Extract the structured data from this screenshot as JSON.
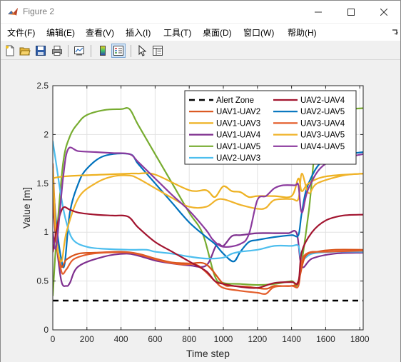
{
  "window": {
    "title": "Figure 2",
    "controls": {
      "minimize": "minimize",
      "maximize": "maximize",
      "close": "close"
    }
  },
  "menu": {
    "items": [
      "文件(F)",
      "编辑(E)",
      "查看(V)",
      "插入(I)",
      "工具(T)",
      "桌面(D)",
      "窗口(W)",
      "帮助(H)"
    ]
  },
  "toolbar": {
    "buttons": [
      "new-figure-icon",
      "open-folder-icon",
      "save-icon",
      "print-icon",
      "link-plot-icon",
      "colorbar-icon",
      "legend-icon",
      "pointer-icon",
      "property-inspector-icon"
    ]
  },
  "chart_data": {
    "type": "line",
    "xlabel": "Time step",
    "ylabel": "Value [m]",
    "xlim": [
      0,
      1820
    ],
    "ylim": [
      0,
      2.5
    ],
    "xticks": [
      0,
      200,
      400,
      600,
      800,
      1000,
      1200,
      1400,
      1600,
      1800
    ],
    "yticks": [
      0,
      0.5,
      1,
      1.5,
      2,
      2.5
    ],
    "ytick_labels": [
      "0",
      "0.5",
      "1",
      "1.5",
      "2",
      "2.5"
    ],
    "grid": true,
    "legend_position": "top-right",
    "series": [
      {
        "name": "Alert Zone",
        "color": "#000000",
        "dashed": true,
        "x": [
          0,
          1820
        ],
        "y": [
          0.3,
          0.3
        ]
      },
      {
        "name": "UAV1-UAV2",
        "color": "#d95319",
        "x": [
          0,
          20,
          50,
          80,
          150,
          250,
          400,
          500,
          600,
          700,
          800,
          900,
          1000,
          1050,
          1150,
          1250,
          1300,
          1400,
          1440,
          1480,
          1550,
          1650,
          1820
        ],
        "y": [
          1.4,
          0.9,
          0.65,
          0.72,
          0.78,
          0.79,
          0.8,
          0.78,
          0.73,
          0.69,
          0.68,
          0.67,
          0.47,
          0.45,
          0.44,
          0.42,
          0.45,
          0.45,
          0.5,
          0.75,
          0.8,
          0.82,
          0.82
        ]
      },
      {
        "name": "UAV1-UAV3",
        "color": "#edb120",
        "x": [
          0,
          20,
          60,
          150,
          300,
          450,
          500,
          600,
          800,
          900,
          950,
          1000,
          1050,
          1100,
          1150,
          1200,
          1300,
          1400,
          1440,
          1460,
          1500,
          1600,
          1820
        ],
        "y": [
          1.55,
          1.56,
          1.57,
          1.58,
          1.59,
          1.6,
          1.6,
          1.59,
          1.43,
          1.43,
          1.36,
          1.47,
          1.42,
          1.41,
          1.36,
          1.37,
          1.37,
          1.37,
          1.55,
          1.42,
          1.5,
          1.57,
          1.6
        ]
      },
      {
        "name": "UAV1-UAV4",
        "color": "#7e2f8e",
        "x": [
          0,
          20,
          50,
          80,
          100,
          150,
          300,
          430,
          500,
          600,
          700,
          800,
          900,
          960,
          1000,
          1050,
          1100,
          1150,
          1200,
          1300,
          1380,
          1430,
          1460,
          1520,
          1650,
          1820
        ],
        "y": [
          1.3,
          0.9,
          0.5,
          0.45,
          0.48,
          0.65,
          0.75,
          0.78,
          0.76,
          0.71,
          0.68,
          0.66,
          0.66,
          0.87,
          0.86,
          0.96,
          0.97,
          0.98,
          0.99,
          0.99,
          0.99,
          0.99,
          0.65,
          0.73,
          0.78,
          0.79
        ]
      },
      {
        "name": "UAV1-UAV5",
        "color": "#77ac30",
        "x": [
          0,
          20,
          60,
          100,
          150,
          200,
          300,
          400,
          450,
          500,
          600,
          700,
          800,
          880,
          950,
          1000,
          1100,
          1200,
          1300,
          1400,
          1440,
          1500,
          1550,
          1650,
          1820
        ],
        "y": [
          0.35,
          0.9,
          1.7,
          1.98,
          2.12,
          2.2,
          2.25,
          2.26,
          2.26,
          2.1,
          1.8,
          1.5,
          1.2,
          0.98,
          0.55,
          0.48,
          0.47,
          0.46,
          0.47,
          0.5,
          0.5,
          1.2,
          1.95,
          2.22,
          2.27
        ]
      },
      {
        "name": "UAV2-UAV3",
        "color": "#4dbeee",
        "x": [
          0,
          20,
          50,
          80,
          120,
          200,
          300,
          450,
          550,
          600,
          700,
          800,
          900,
          1000,
          1050,
          1100,
          1200,
          1300,
          1400,
          1440,
          1460,
          1520,
          1650,
          1820
        ],
        "y": [
          1.93,
          1.7,
          1.35,
          1.1,
          0.92,
          0.85,
          0.83,
          0.82,
          0.82,
          0.8,
          0.78,
          0.75,
          0.73,
          0.74,
          0.78,
          0.8,
          0.82,
          0.86,
          0.86,
          0.86,
          0.72,
          0.78,
          0.8,
          0.8
        ]
      },
      {
        "name": "UAV2-UAV4",
        "color": "#a2142f",
        "x": [
          0,
          30,
          60,
          100,
          150,
          250,
          350,
          440,
          500,
          600,
          700,
          800,
          900,
          950,
          1000,
          1100,
          1200,
          1300,
          1400,
          1440,
          1460,
          1520,
          1600,
          1700,
          1820
        ],
        "y": [
          0.8,
          1.1,
          1.25,
          1.23,
          1.2,
          1.18,
          1.17,
          1.16,
          1.05,
          0.9,
          0.8,
          0.7,
          0.6,
          0.5,
          0.47,
          0.44,
          0.43,
          0.48,
          0.49,
          0.49,
          0.8,
          1.0,
          1.12,
          1.17,
          1.18
        ]
      },
      {
        "name": "UAV2-UAV5",
        "color": "#0072bd",
        "x": [
          0,
          20,
          50,
          70,
          100,
          150,
          200,
          300,
          450,
          500,
          600,
          700,
          800,
          900,
          950,
          1000,
          1060,
          1100,
          1150,
          1200,
          1300,
          1400,
          1440,
          1460,
          1500,
          1600,
          1820
        ],
        "y": [
          1.55,
          1.1,
          0.72,
          0.68,
          1.2,
          1.5,
          1.65,
          1.78,
          1.8,
          1.7,
          1.5,
          1.3,
          1.1,
          0.95,
          0.88,
          0.78,
          0.7,
          0.8,
          0.9,
          0.92,
          0.95,
          0.97,
          0.97,
          1.2,
          1.5,
          1.75,
          1.82
        ]
      },
      {
        "name": "UAV3-UAV4",
        "color": "#e35d2a",
        "x": [
          0,
          20,
          50,
          80,
          120,
          200,
          300,
          450,
          550,
          650,
          750,
          850,
          950,
          1000,
          1100,
          1200,
          1250,
          1300,
          1400,
          1440,
          1460,
          1500,
          1600,
          1820
        ],
        "y": [
          1.7,
          1.0,
          0.6,
          0.62,
          0.72,
          0.77,
          0.79,
          0.79,
          0.75,
          0.7,
          0.67,
          0.66,
          0.5,
          0.43,
          0.4,
          0.38,
          0.37,
          0.44,
          0.45,
          0.45,
          0.7,
          0.79,
          0.8,
          0.81
        ]
      },
      {
        "name": "UAV3-UAV5",
        "color": "#f0b32a",
        "x": [
          0,
          20,
          50,
          80,
          150,
          250,
          350,
          450,
          500,
          600,
          700,
          800,
          900,
          980,
          1100,
          1200,
          1250,
          1300,
          1400,
          1440,
          1460,
          1500,
          1550,
          1700,
          1820
        ],
        "y": [
          1.65,
          0.95,
          0.7,
          1.0,
          1.35,
          1.5,
          1.57,
          1.58,
          1.55,
          1.45,
          1.35,
          1.26,
          1.26,
          1.34,
          1.28,
          1.24,
          1.25,
          1.33,
          1.34,
          1.34,
          1.6,
          1.4,
          1.5,
          1.58,
          1.6
        ]
      },
      {
        "name": "UAV4-UAV5",
        "color": "#8b3a9e",
        "x": [
          0,
          20,
          60,
          90,
          150,
          250,
          350,
          450,
          500,
          600,
          700,
          800,
          900,
          940,
          1000,
          1100,
          1150,
          1200,
          1250,
          1300,
          1350,
          1420,
          1440,
          1460,
          1500,
          1600,
          1820
        ],
        "y": [
          1.0,
          0.85,
          1.55,
          1.85,
          1.83,
          1.82,
          1.81,
          1.8,
          1.72,
          1.55,
          1.38,
          1.22,
          1.02,
          0.92,
          0.85,
          0.88,
          0.98,
          1.33,
          1.37,
          1.45,
          1.48,
          1.48,
          1.48,
          1.2,
          1.45,
          1.7,
          1.8
        ]
      }
    ]
  }
}
